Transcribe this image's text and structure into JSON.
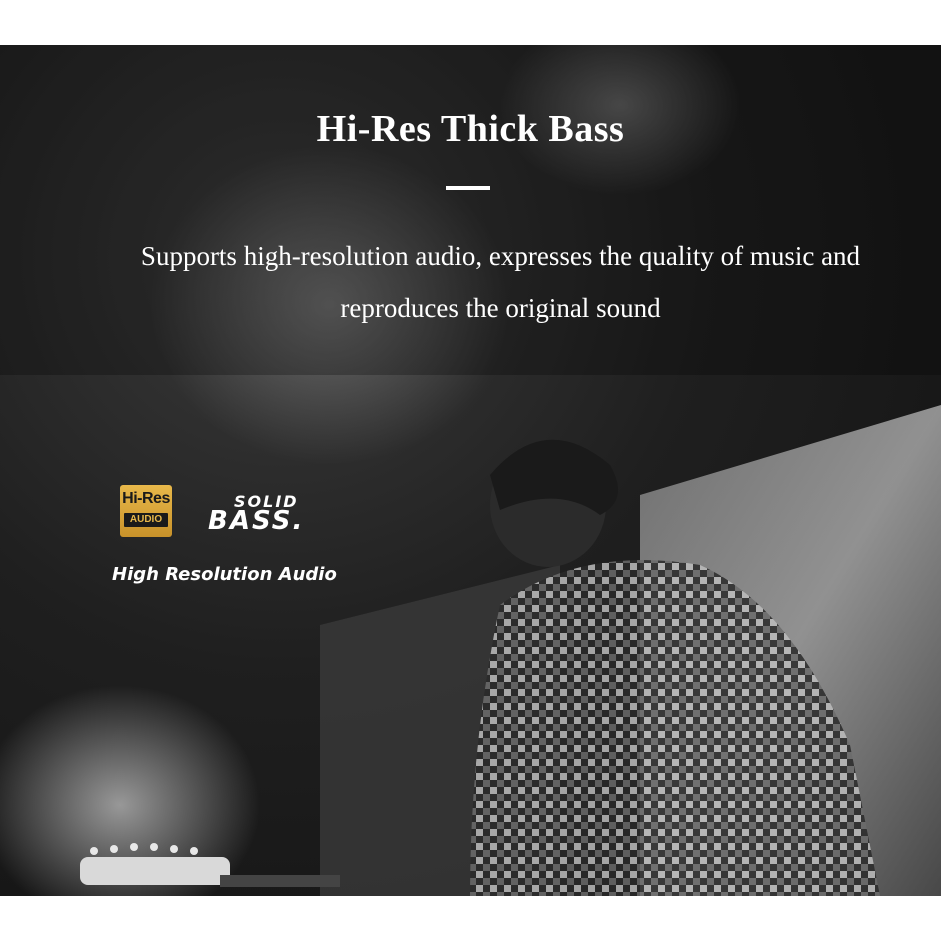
{
  "hero": {
    "title": "Hi-Res Thick Bass",
    "description_line1": "Supports high-resolution audio, expresses the quality of music and",
    "description_line2": "reproduces the original sound"
  },
  "badges": {
    "hires_top": "Hi-Res",
    "hires_bottom": "AUDIO",
    "solid_bass_top": "SOLID",
    "solid_bass_bottom": "BASS.",
    "caption": "High Resolution Audio"
  },
  "colors": {
    "background": "#1c1c1c",
    "text": "#ffffff",
    "hires_gold": "#d9a63a"
  }
}
